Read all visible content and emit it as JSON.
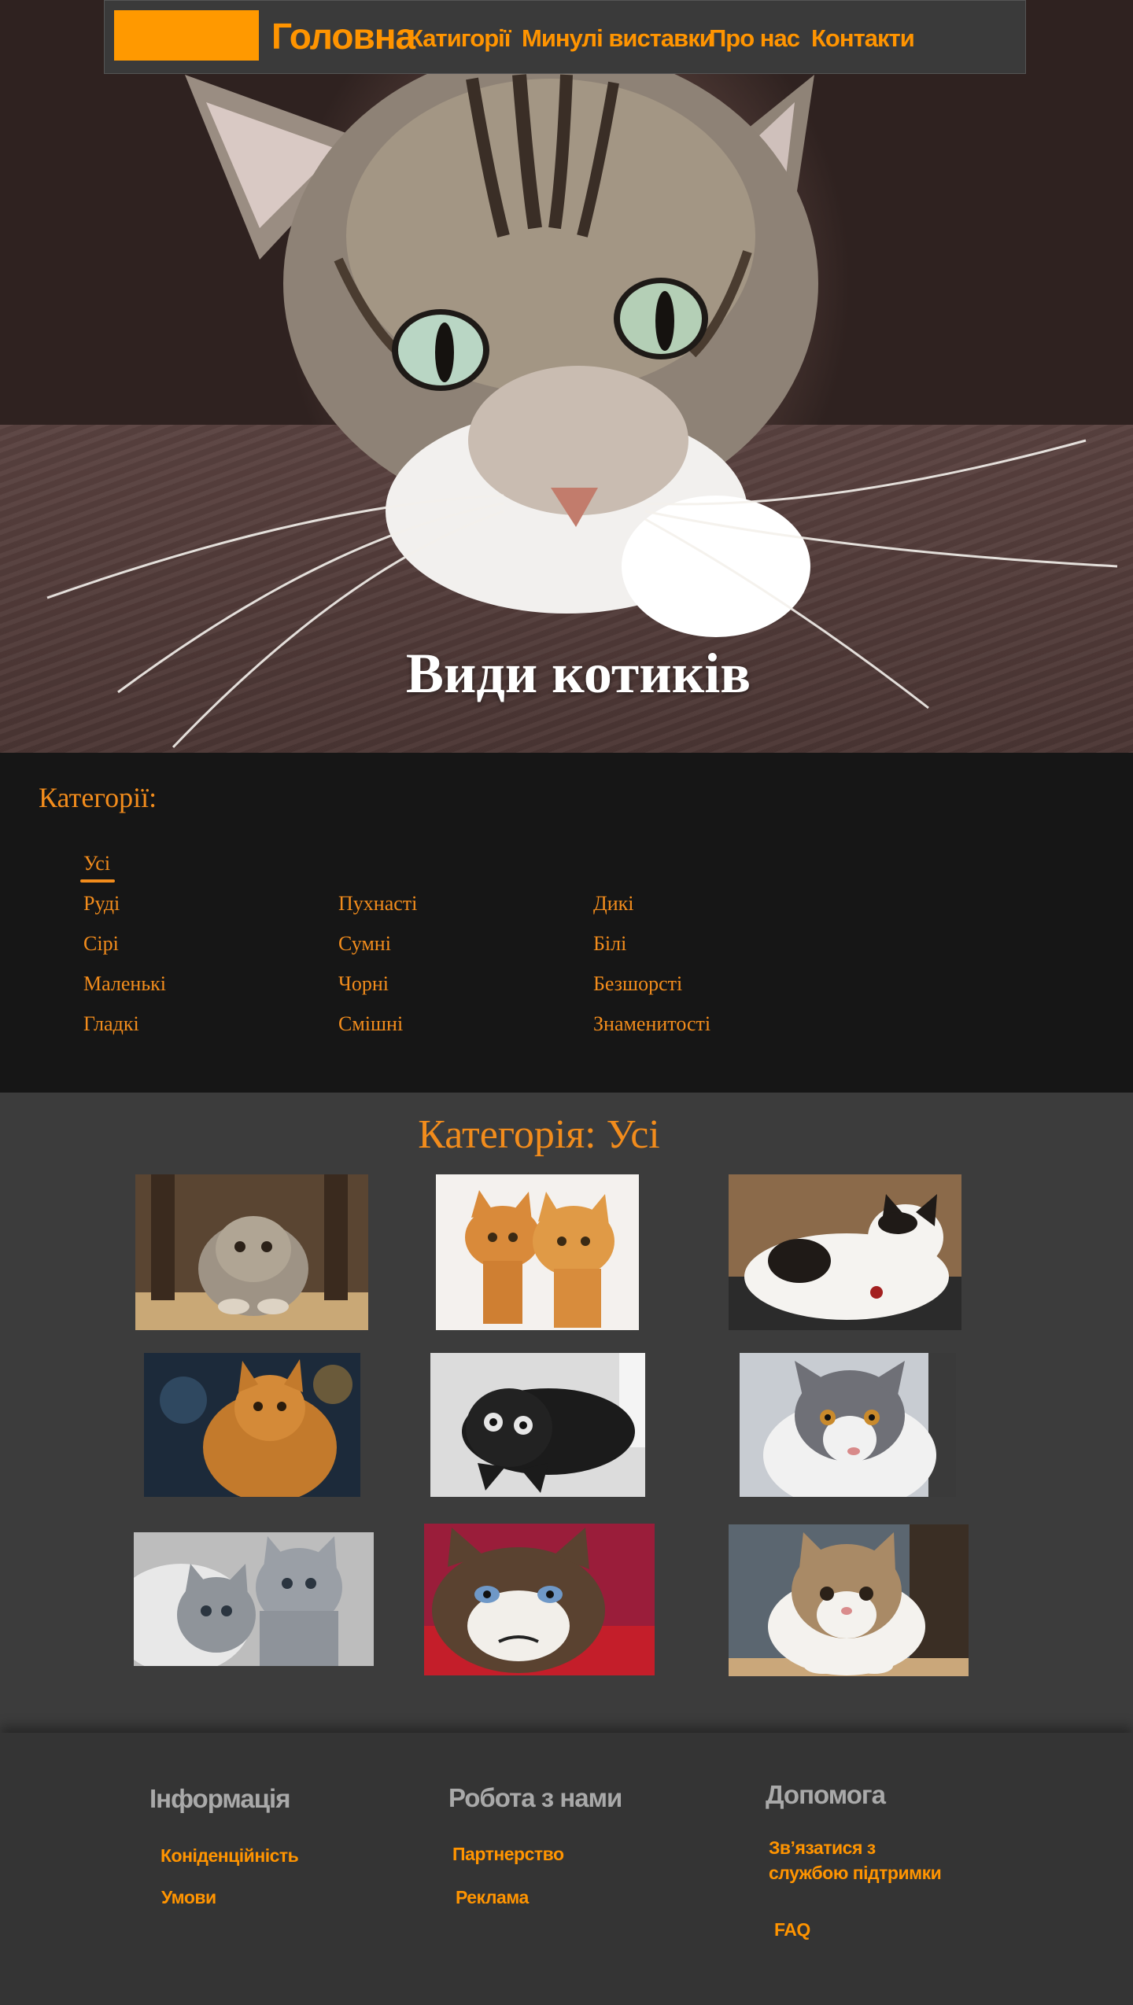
{
  "nav": {
    "home": "Головна",
    "items": [
      {
        "label": "Катигорії"
      },
      {
        "label": "Минулі виставки"
      },
      {
        "label": "Про нас"
      },
      {
        "label": "Контакти"
      }
    ]
  },
  "hero": {
    "title": "Види котиків"
  },
  "categories": {
    "heading": "Категорії:",
    "active": "Усі",
    "items": [
      "Руді",
      "Пухнасті",
      "Дикі",
      "Сірі",
      "Сумні",
      "Білі",
      "Маленькі",
      "Чорні",
      "Безшорсті",
      "Гладкі",
      "Смішні",
      "Знаменитості"
    ]
  },
  "gallery": {
    "heading": "Категорія: Усі",
    "photos": [
      "fold-kitten-icon",
      "ginger-kittens-icon",
      "calico-cat-icon",
      "maine-coon-icon",
      "black-cat-icon",
      "grey-white-cat-icon",
      "grey-kittens-icon",
      "grumpy-cat-icon",
      "tabby-white-cat-icon"
    ]
  },
  "footer": {
    "columns": [
      {
        "title": "Інформація",
        "links": [
          "Коніденційність",
          "Умови"
        ]
      },
      {
        "title": "Робота з нами",
        "links": [
          "Партнерство",
          "Реклама"
        ]
      },
      {
        "title": "Допомога",
        "links": [
          "Зв’язатися з службою підтримки",
          "FAQ"
        ]
      }
    ]
  },
  "colors": {
    "accent": "#ff9400",
    "nav_bg": "#3a3a3a",
    "gallery_bg": "#3c3c3c",
    "categories_bg": "#161616"
  }
}
